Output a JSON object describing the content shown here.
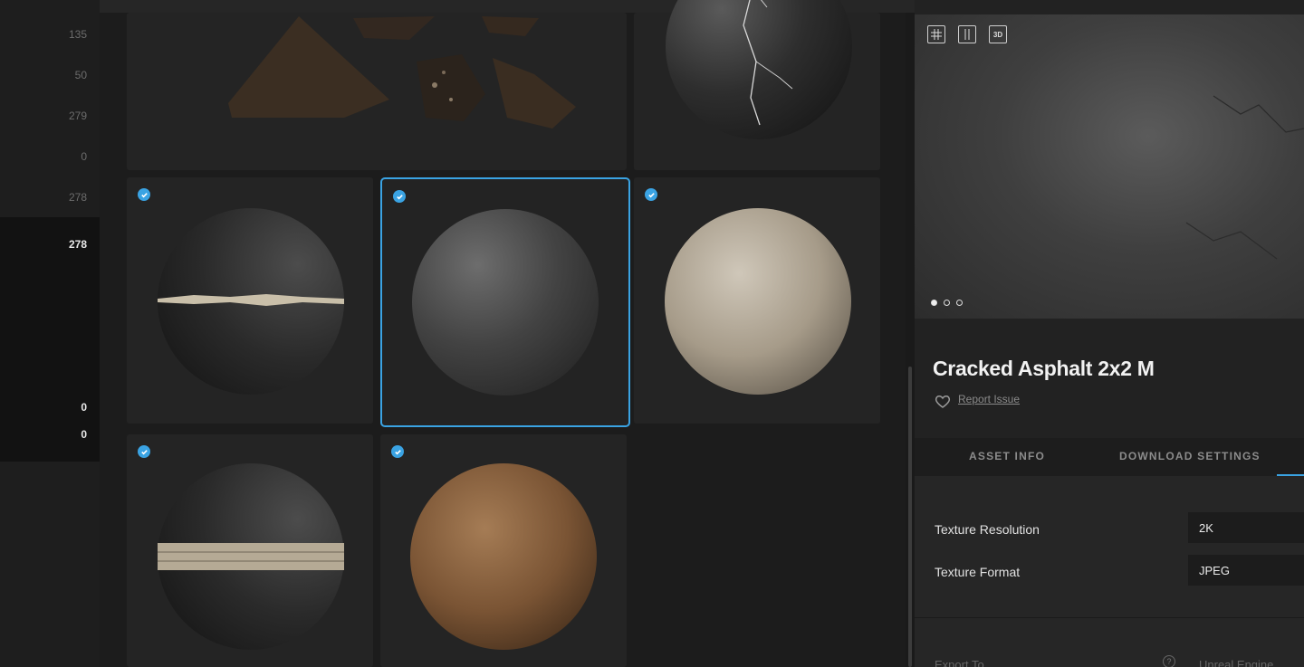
{
  "sidebar": {
    "counts": [
      "135",
      "50",
      "279",
      "0",
      "278",
      "278",
      "0",
      "0"
    ]
  },
  "asset": {
    "title": "Cracked Asphalt 2x2 M",
    "report_label": "Report Issue"
  },
  "preview": {
    "view_buttons": [
      "grid-view",
      "columns-view",
      "3D"
    ],
    "dots": 3,
    "active_dot": 0
  },
  "tabs": {
    "asset_info": "ASSET INFO",
    "download_settings": "DOWNLOAD SETTINGS",
    "active": "download_settings"
  },
  "settings": {
    "texture_resolution_label": "Texture Resolution",
    "texture_resolution_value": "2K",
    "texture_format_label": "Texture Format",
    "texture_format_value": "JPEG",
    "export_to_label": "Export To",
    "export_to_value": "Unreal Engine"
  },
  "materials": [
    {
      "name": "debris-pieces",
      "checked": false
    },
    {
      "name": "cracked-dark",
      "checked": false
    },
    {
      "name": "dark-sphere-crack-band",
      "checked": true
    },
    {
      "name": "cracked-asphalt",
      "checked": true,
      "selected": true
    },
    {
      "name": "light-concrete",
      "checked": true
    },
    {
      "name": "dark-sphere-brick-band",
      "checked": true
    },
    {
      "name": "brown-soil",
      "checked": true
    }
  ],
  "colors": {
    "accent": "#3aa3e3",
    "background": "#1a1a1a",
    "panel": "#222222"
  }
}
